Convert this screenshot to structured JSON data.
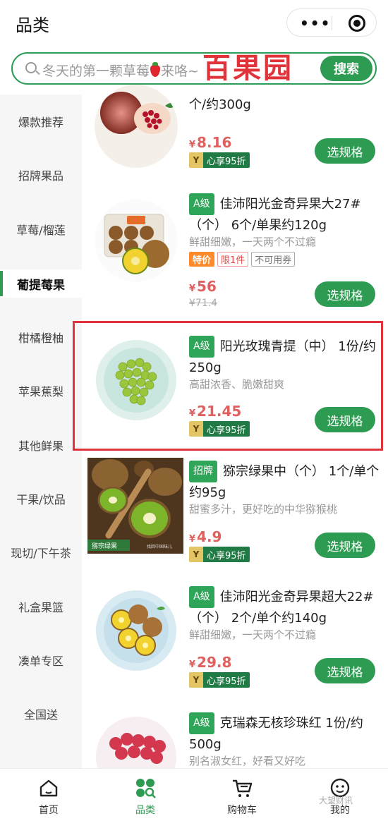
{
  "header": {
    "title": "品类"
  },
  "search": {
    "placeholder_before": "冬天的第一颗草莓",
    "placeholder_after": "来咯~",
    "button_label": "搜索"
  },
  "brand_watermark": "百果园",
  "sidebar": {
    "items": [
      {
        "label": "爆款推荐",
        "active": false
      },
      {
        "label": "招牌果品",
        "active": false
      },
      {
        "label": "草莓/榴莲",
        "active": false
      },
      {
        "label": "葡提莓果",
        "active": true
      },
      {
        "label": "柑橘橙柚",
        "active": false
      },
      {
        "label": "苹果蕉梨",
        "active": false
      },
      {
        "label": "其他鲜果",
        "active": false
      },
      {
        "label": "干果/饮品",
        "active": false
      },
      {
        "label": "现切/下午茶",
        "active": false
      },
      {
        "label": "礼盒果篮",
        "active": false
      },
      {
        "label": "凑单专区",
        "active": false
      },
      {
        "label": "全国送",
        "active": false
      }
    ]
  },
  "products": [
    {
      "name": "个/约300g",
      "price": "8.16",
      "currency": "¥",
      "vip_label": "心享95折",
      "spec_button": "选规格"
    },
    {
      "grade": "A级",
      "name": "佳沛阳光金奇异果大27#（个） 6个/单果约120g",
      "desc": "鲜甜细嫩，一天两个不过瘾",
      "tag_special": "特价",
      "tag_limit": "限1件",
      "tag_nocoupon": "不可用券",
      "price": "56",
      "currency": "¥",
      "old_price": "¥71.4",
      "spec_button": "选规格"
    },
    {
      "grade": "A级",
      "name": "阳光玫瑰青提（中） 1份/约250g",
      "desc": "高甜浓香、脆嫩甜爽",
      "price": "21.45",
      "currency": "¥",
      "vip_label": "心享95折",
      "spec_button": "选规格"
    },
    {
      "grade": "招牌",
      "name": "猕宗绿果中（个） 1个/单个约95g",
      "desc": "甜蜜多汁，更好吃的中华猕猴桃",
      "price": "4.9",
      "currency": "¥",
      "vip_label": "心享95折",
      "spec_button": "选规格",
      "img_logo": "猕宗绿果",
      "img_tagline": "找回中国味儿"
    },
    {
      "grade": "A级",
      "name": "佳沛阳光金奇异果超大22#（个） 2个/单个约140g",
      "desc": "鲜甜细嫩，一天两个不过瘾",
      "price": "29.8",
      "currency": "¥",
      "vip_label": "心享95折",
      "spec_button": "选规格"
    },
    {
      "grade": "A级",
      "name": "克瑞森无核珍珠红 1份/约500g",
      "desc": "别名淑女红，好看又好吃"
    }
  ],
  "vip_icon_letter": "Y",
  "bottom_nav": [
    {
      "label": "首页",
      "icon": "home-icon",
      "active": false
    },
    {
      "label": "品类",
      "icon": "category-icon",
      "active": true
    },
    {
      "label": "购物车",
      "icon": "cart-icon",
      "active": false
    },
    {
      "label": "我的",
      "icon": "profile-icon",
      "active": false
    }
  ],
  "footer_watermark": "大望财讯",
  "colors": {
    "accent": "#2e9b52",
    "price": "#e06060",
    "highlight": "#e0333a"
  }
}
